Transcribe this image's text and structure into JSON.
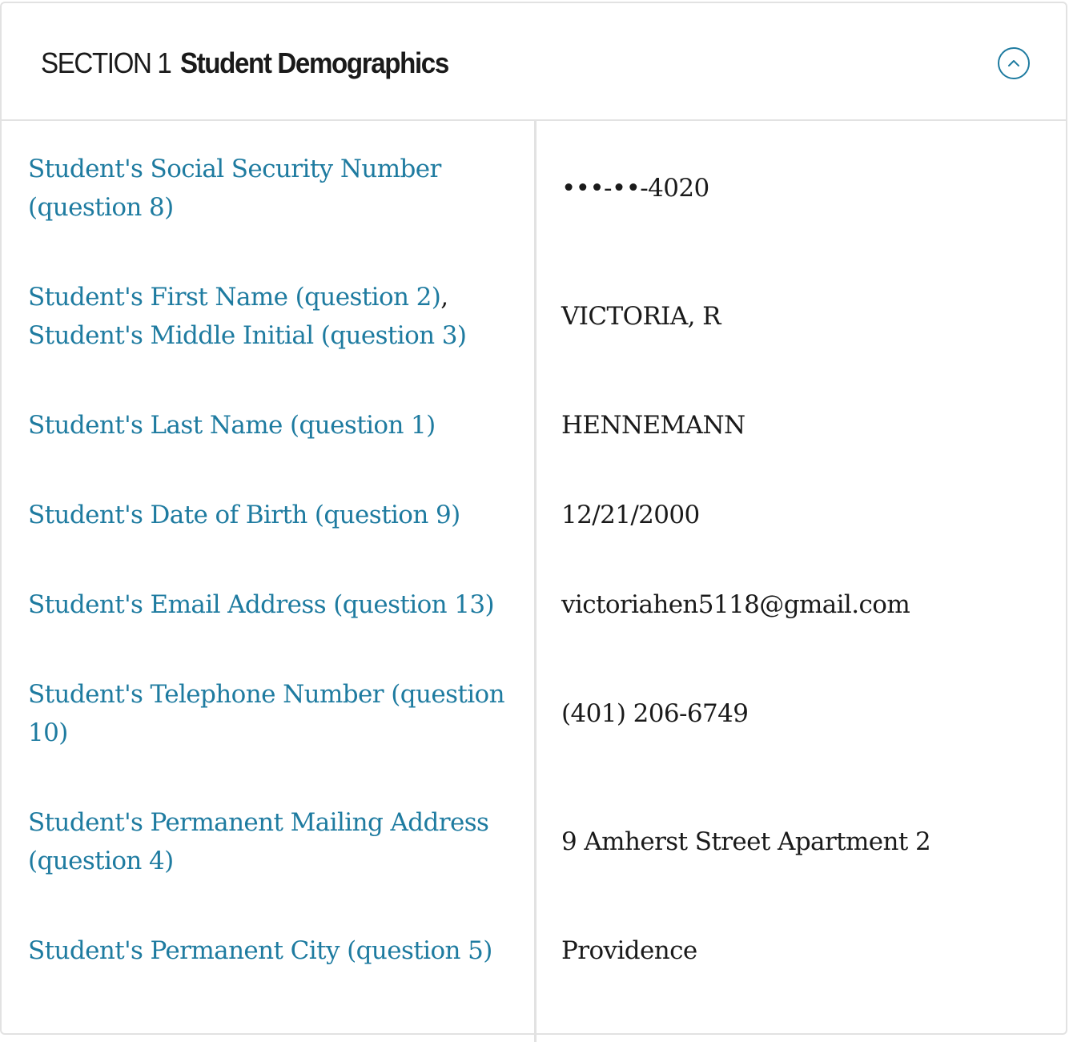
{
  "section": {
    "number": "SECTION 1",
    "title": "Student Demographics",
    "toggle_icon": "chevron-up-circle-icon",
    "accent_color": "#1e7ba0"
  },
  "rows": [
    {
      "labels": [
        "Student's Social Security Number (question 8)"
      ],
      "value": "•••-••-4020"
    },
    {
      "labels": [
        "Student's First Name (question 2)",
        "Student's Middle Initial (question 3)"
      ],
      "separator": ",",
      "value": "VICTORIA, R"
    },
    {
      "labels": [
        "Student's Last Name (question 1)"
      ],
      "value": "HENNEMANN"
    },
    {
      "labels": [
        "Student's Date of Birth (question 9)"
      ],
      "value": "12/21/2000"
    },
    {
      "labels": [
        "Student's Email Address (question 13)"
      ],
      "value": "victoriahen5118@gmail.com"
    },
    {
      "labels": [
        "Student's Telephone Number (question 10)"
      ],
      "value": "(401) 206-6749"
    },
    {
      "labels": [
        "Student's Permanent Mailing Address (question 4)"
      ],
      "value": "9 Amherst Street Apartment 2"
    },
    {
      "labels": [
        "Student's Permanent City (question 5)"
      ],
      "value": "Providence"
    }
  ]
}
